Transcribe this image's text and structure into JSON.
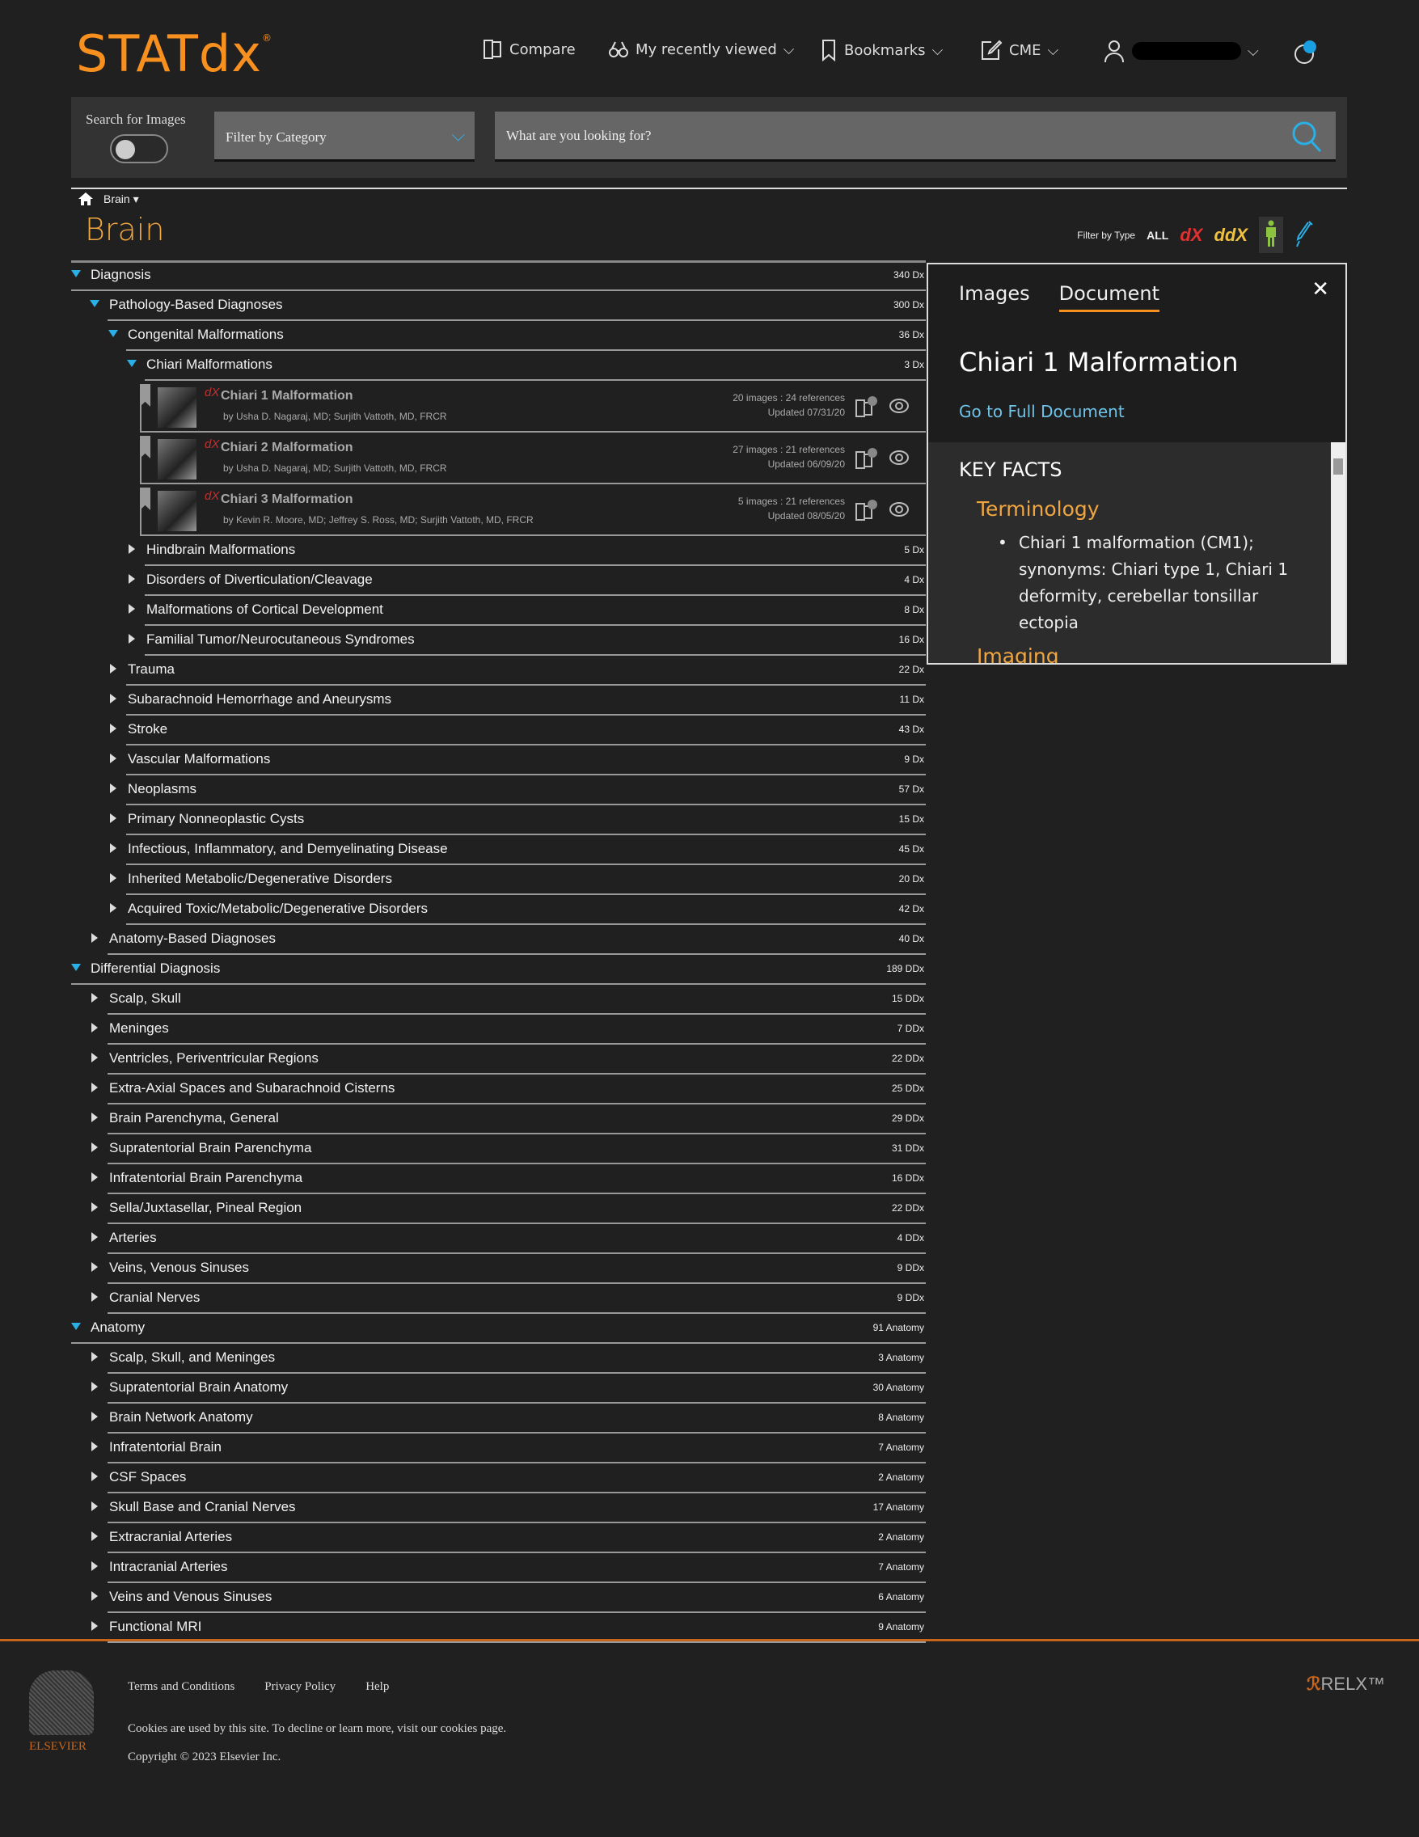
{
  "header": {
    "logo": "STATdx",
    "nav": {
      "compare": "Compare",
      "recent": "My recently viewed",
      "bookmarks": "Bookmarks",
      "cme": "CME"
    }
  },
  "search": {
    "images_label": "Search for Images",
    "images_toggle": false,
    "category": "Filter by Category",
    "placeholder": "What are you looking for?"
  },
  "breadcrumb": {
    "item": "Brain"
  },
  "page_title": "Brain",
  "filter_type": {
    "label": "Filter by Type",
    "all": "ALL",
    "dx": "dX",
    "ddx": "ddX",
    "active": "anatomy"
  },
  "colors": {
    "accent": "#f7901e",
    "link": "#6fc3e8",
    "arrow": "#2ab0e6",
    "bg": "#202020"
  },
  "tree_top": [
    {
      "label": "Diagnosis",
      "count": "340 Dx",
      "level": 0,
      "expanded": true
    },
    {
      "label": "Pathology-Based Diagnoses",
      "count": "300 Dx",
      "level": 1,
      "expanded": true
    },
    {
      "label": "Congenital Malformations",
      "count": "36 Dx",
      "level": 2,
      "expanded": true
    },
    {
      "label": "Chiari Malformations",
      "count": "3 Dx",
      "level": 3,
      "expanded": true
    }
  ],
  "docs": [
    {
      "title": "Chiari 1 Malformation",
      "authors": "by Usha D. Nagaraj, MD;  Surjith Vattoth, MD, FRCR",
      "stats": "20 images : 24 references",
      "updated": "Updated 07/31/20"
    },
    {
      "title": "Chiari 2 Malformation",
      "authors": "by Usha D. Nagaraj, MD;  Surjith Vattoth, MD, FRCR",
      "stats": "27 images : 21 references",
      "updated": "Updated 06/09/20"
    },
    {
      "title": "Chiari 3 Malformation",
      "authors": "by Kevin R. Moore, MD;  Jeffrey S. Ross, MD;  Surjith Vattoth, MD, FRCR",
      "stats": "5 images : 21 references",
      "updated": "Updated 08/05/20"
    }
  ],
  "tree_rest": [
    {
      "label": "Hindbrain Malformations",
      "count": "5 Dx",
      "level": 3
    },
    {
      "label": "Disorders of Diverticulation/Cleavage",
      "count": "4 Dx",
      "level": 3
    },
    {
      "label": "Malformations of Cortical Development",
      "count": "8 Dx",
      "level": 3
    },
    {
      "label": "Familial Tumor/Neurocutaneous Syndromes",
      "count": "16 Dx",
      "level": 3
    },
    {
      "label": "Trauma",
      "count": "22 Dx",
      "level": 2
    },
    {
      "label": "Subarachnoid Hemorrhage and Aneurysms",
      "count": "11 Dx",
      "level": 2
    },
    {
      "label": "Stroke",
      "count": "43 Dx",
      "level": 2
    },
    {
      "label": "Vascular Malformations",
      "count": "9 Dx",
      "level": 2
    },
    {
      "label": "Neoplasms",
      "count": "57 Dx",
      "level": 2
    },
    {
      "label": "Primary Nonneoplastic Cysts",
      "count": "15 Dx",
      "level": 2
    },
    {
      "label": "Infectious, Inflammatory, and Demyelinating Disease",
      "count": "45 Dx",
      "level": 2
    },
    {
      "label": "Inherited Metabolic/Degenerative Disorders",
      "count": "20 Dx",
      "level": 2
    },
    {
      "label": "Acquired Toxic/Metabolic/Degenerative Disorders",
      "count": "42 Dx",
      "level": 2
    },
    {
      "label": "Anatomy-Based Diagnoses",
      "count": "40 Dx",
      "level": 1
    },
    {
      "label": "Differential Diagnosis",
      "count": "189 DDx",
      "level": 0,
      "expanded": true
    },
    {
      "label": "Scalp, Skull",
      "count": "15 DDx",
      "level": 1
    },
    {
      "label": "Meninges",
      "count": "7 DDx",
      "level": 1
    },
    {
      "label": "Ventricles, Periventricular Regions",
      "count": "22 DDx",
      "level": 1
    },
    {
      "label": "Extra-Axial Spaces and Subarachnoid Cisterns",
      "count": "25 DDx",
      "level": 1
    },
    {
      "label": "Brain Parenchyma, General",
      "count": "29 DDx",
      "level": 1
    },
    {
      "label": "Supratentorial Brain Parenchyma",
      "count": "31 DDx",
      "level": 1
    },
    {
      "label": "Infratentorial Brain Parenchyma",
      "count": "16 DDx",
      "level": 1
    },
    {
      "label": "Sella/Juxtasellar, Pineal Region",
      "count": "22 DDx",
      "level": 1
    },
    {
      "label": "Arteries",
      "count": "4 DDx",
      "level": 1
    },
    {
      "label": "Veins, Venous Sinuses",
      "count": "9 DDx",
      "level": 1
    },
    {
      "label": "Cranial Nerves",
      "count": "9 DDx",
      "level": 1
    },
    {
      "label": "Anatomy",
      "count": "91 Anatomy",
      "level": 0,
      "expanded": true
    },
    {
      "label": "Scalp, Skull, and Meninges",
      "count": "3 Anatomy",
      "level": 1
    },
    {
      "label": "Supratentorial Brain Anatomy",
      "count": "30 Anatomy",
      "level": 1
    },
    {
      "label": "Brain Network Anatomy",
      "count": "8 Anatomy",
      "level": 1
    },
    {
      "label": "Infratentorial Brain",
      "count": "7 Anatomy",
      "level": 1
    },
    {
      "label": "CSF Spaces",
      "count": "2 Anatomy",
      "level": 1
    },
    {
      "label": "Skull Base and Cranial Nerves",
      "count": "17 Anatomy",
      "level": 1
    },
    {
      "label": "Extracranial Arteries",
      "count": "2 Anatomy",
      "level": 1
    },
    {
      "label": "Intracranial Arteries",
      "count": "7 Anatomy",
      "level": 1
    },
    {
      "label": "Veins and Venous Sinuses",
      "count": "6 Anatomy",
      "level": 1
    },
    {
      "label": "Functional MRI",
      "count": "9 Anatomy",
      "level": 1
    }
  ],
  "panel": {
    "tabs": [
      "Images",
      "Document"
    ],
    "active_tab": "Document",
    "title": "Chiari 1 Malformation",
    "link": "Go to Full Document",
    "key_facts": "KEY FACTS",
    "section1": "Terminology",
    "bullet": "Chiari 1 malformation (CM1); synonyms: Chiari type 1, Chiari 1 deformity, cerebellar tonsillar ectopia",
    "section2": "Imaging"
  },
  "footer": {
    "links": [
      "Terms and Conditions",
      "Privacy Policy",
      "Help"
    ],
    "cookies": "Cookies are used by this site. To decline or learn more, visit our cookies page.",
    "copyright": "Copyright © 2023 Elsevier Inc.",
    "elsevier": "ELSEVIER",
    "relx": "RELX"
  }
}
